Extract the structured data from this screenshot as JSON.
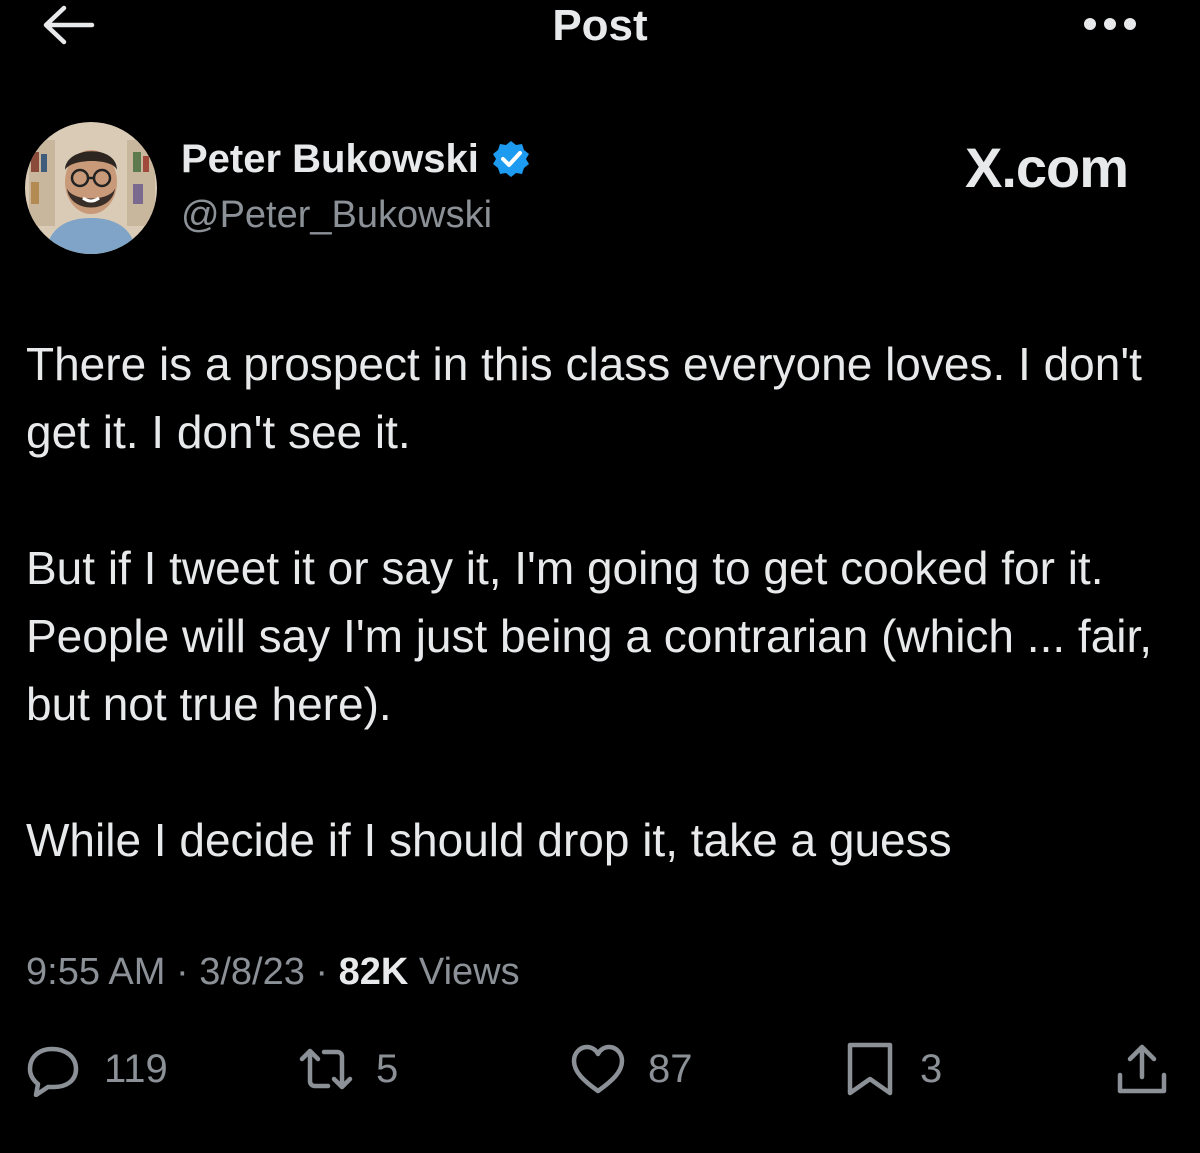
{
  "topbar": {
    "title": "Post"
  },
  "author": {
    "name": "Peter Bukowski",
    "handle": "@Peter_Bukowski",
    "verified": true,
    "site_logo": "X.com"
  },
  "post": {
    "paragraphs": [
      "There is a prospect in this class everyone loves. I don't get it. I don't see it.",
      "But if I tweet it or say it, I'm going to get cooked for it. People will say I'm just being a contrarian (which ... fair, but not true here).",
      "While I decide if I should drop it, take a guess"
    ]
  },
  "meta": {
    "time": "9:55 AM",
    "separator": "·",
    "date": "3/8/23",
    "views_count": "82K",
    "views_label": "Views"
  },
  "actions": {
    "replies": "119",
    "reposts": "5",
    "likes": "87",
    "bookmarks": "3"
  },
  "icons": {
    "back": "arrow-left-icon",
    "more": "more-horizontal-icon",
    "verified": "verified-badge-icon",
    "reply": "reply-icon",
    "repost": "repost-icon",
    "like": "heart-icon",
    "bookmark": "bookmark-icon",
    "share": "share-icon"
  },
  "colors": {
    "background": "#000000",
    "text": "#e7e9ea",
    "secondary": "#8b9197",
    "verified": "#1d9bf0"
  }
}
